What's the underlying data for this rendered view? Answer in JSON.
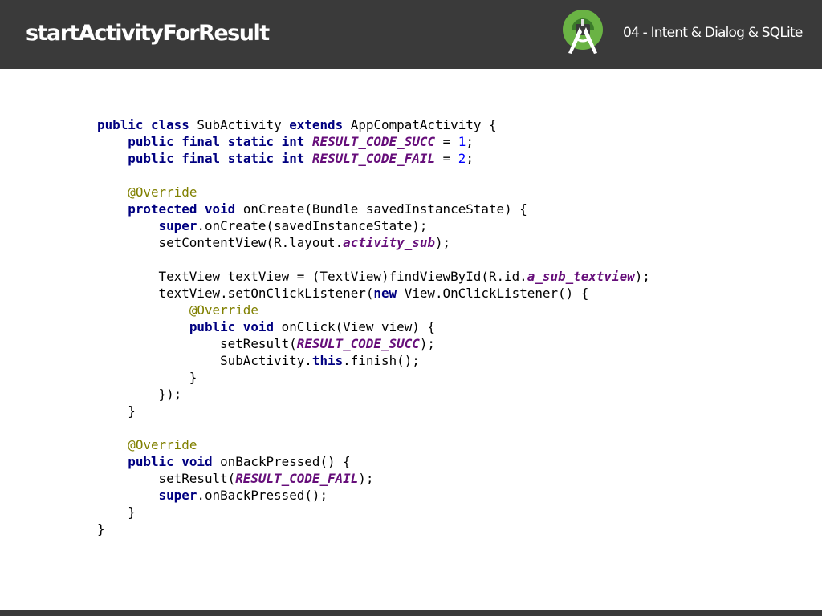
{
  "header": {
    "title": "startActivityForResult",
    "section": "04 - Intent & Dialog & SQLite",
    "logo_icon": "android-studio-icon"
  },
  "colors": {
    "header_bg": "#3a3a3a",
    "keyword": "#000080",
    "field": "#660e7a",
    "number": "#0000ff",
    "annotation": "#808000"
  },
  "code": {
    "language": "java",
    "lines": [
      [
        {
          "t": "kw",
          "v": "public"
        },
        {
          "t": "p",
          "v": " "
        },
        {
          "t": "kw",
          "v": "class"
        },
        {
          "t": "p",
          "v": " SubActivity "
        },
        {
          "t": "kw",
          "v": "extends"
        },
        {
          "t": "p",
          "v": " AppCompatActivity {"
        }
      ],
      [
        {
          "t": "p",
          "v": "    "
        },
        {
          "t": "kw",
          "v": "public"
        },
        {
          "t": "p",
          "v": " "
        },
        {
          "t": "kw",
          "v": "final"
        },
        {
          "t": "p",
          "v": " "
        },
        {
          "t": "kw",
          "v": "static"
        },
        {
          "t": "p",
          "v": " "
        },
        {
          "t": "kw",
          "v": "int"
        },
        {
          "t": "p",
          "v": " "
        },
        {
          "t": "field",
          "v": "RESULT_CODE_SUCC"
        },
        {
          "t": "p",
          "v": " = "
        },
        {
          "t": "num",
          "v": "1"
        },
        {
          "t": "p",
          "v": ";"
        }
      ],
      [
        {
          "t": "p",
          "v": "    "
        },
        {
          "t": "kw",
          "v": "public"
        },
        {
          "t": "p",
          "v": " "
        },
        {
          "t": "kw",
          "v": "final"
        },
        {
          "t": "p",
          "v": " "
        },
        {
          "t": "kw",
          "v": "static"
        },
        {
          "t": "p",
          "v": " "
        },
        {
          "t": "kw",
          "v": "int"
        },
        {
          "t": "p",
          "v": " "
        },
        {
          "t": "field",
          "v": "RESULT_CODE_FAIL"
        },
        {
          "t": "p",
          "v": " = "
        },
        {
          "t": "num",
          "v": "2"
        },
        {
          "t": "p",
          "v": ";"
        }
      ],
      [],
      [
        {
          "t": "p",
          "v": "    "
        },
        {
          "t": "ann",
          "v": "@Override"
        }
      ],
      [
        {
          "t": "p",
          "v": "    "
        },
        {
          "t": "kw",
          "v": "protected"
        },
        {
          "t": "p",
          "v": " "
        },
        {
          "t": "kw",
          "v": "void"
        },
        {
          "t": "p",
          "v": " onCreate(Bundle savedInstanceState) {"
        }
      ],
      [
        {
          "t": "p",
          "v": "        "
        },
        {
          "t": "kw",
          "v": "super"
        },
        {
          "t": "p",
          "v": ".onCreate(savedInstanceState);"
        }
      ],
      [
        {
          "t": "p",
          "v": "        setContentView(R.layout."
        },
        {
          "t": "field",
          "v": "activity_sub"
        },
        {
          "t": "p",
          "v": ");"
        }
      ],
      [],
      [
        {
          "t": "p",
          "v": "        TextView textView = (TextView)findViewById(R.id."
        },
        {
          "t": "field",
          "v": "a_sub_textview"
        },
        {
          "t": "p",
          "v": ");"
        }
      ],
      [
        {
          "t": "p",
          "v": "        textView.setOnClickListener("
        },
        {
          "t": "kw",
          "v": "new"
        },
        {
          "t": "p",
          "v": " View.OnClickListener() {"
        }
      ],
      [
        {
          "t": "p",
          "v": "            "
        },
        {
          "t": "ann",
          "v": "@Override"
        }
      ],
      [
        {
          "t": "p",
          "v": "            "
        },
        {
          "t": "kw",
          "v": "public"
        },
        {
          "t": "p",
          "v": " "
        },
        {
          "t": "kw",
          "v": "void"
        },
        {
          "t": "p",
          "v": " onClick(View view) {"
        }
      ],
      [
        {
          "t": "p",
          "v": "                setResult("
        },
        {
          "t": "field",
          "v": "RESULT_CODE_SUCC"
        },
        {
          "t": "p",
          "v": ");"
        }
      ],
      [
        {
          "t": "p",
          "v": "                SubActivity."
        },
        {
          "t": "kw",
          "v": "this"
        },
        {
          "t": "p",
          "v": ".finish();"
        }
      ],
      [
        {
          "t": "p",
          "v": "            }"
        }
      ],
      [
        {
          "t": "p",
          "v": "        });"
        }
      ],
      [
        {
          "t": "p",
          "v": "    }"
        }
      ],
      [],
      [
        {
          "t": "p",
          "v": "    "
        },
        {
          "t": "ann",
          "v": "@Override"
        }
      ],
      [
        {
          "t": "p",
          "v": "    "
        },
        {
          "t": "kw",
          "v": "public"
        },
        {
          "t": "p",
          "v": " "
        },
        {
          "t": "kw",
          "v": "void"
        },
        {
          "t": "p",
          "v": " onBackPressed() {"
        }
      ],
      [
        {
          "t": "p",
          "v": "        setResult("
        },
        {
          "t": "field",
          "v": "RESULT_CODE_FAIL"
        },
        {
          "t": "p",
          "v": ");"
        }
      ],
      [
        {
          "t": "p",
          "v": "        "
        },
        {
          "t": "kw",
          "v": "super"
        },
        {
          "t": "p",
          "v": ".onBackPressed();"
        }
      ],
      [
        {
          "t": "p",
          "v": "    }"
        }
      ],
      [
        {
          "t": "p",
          "v": "}"
        }
      ]
    ]
  }
}
